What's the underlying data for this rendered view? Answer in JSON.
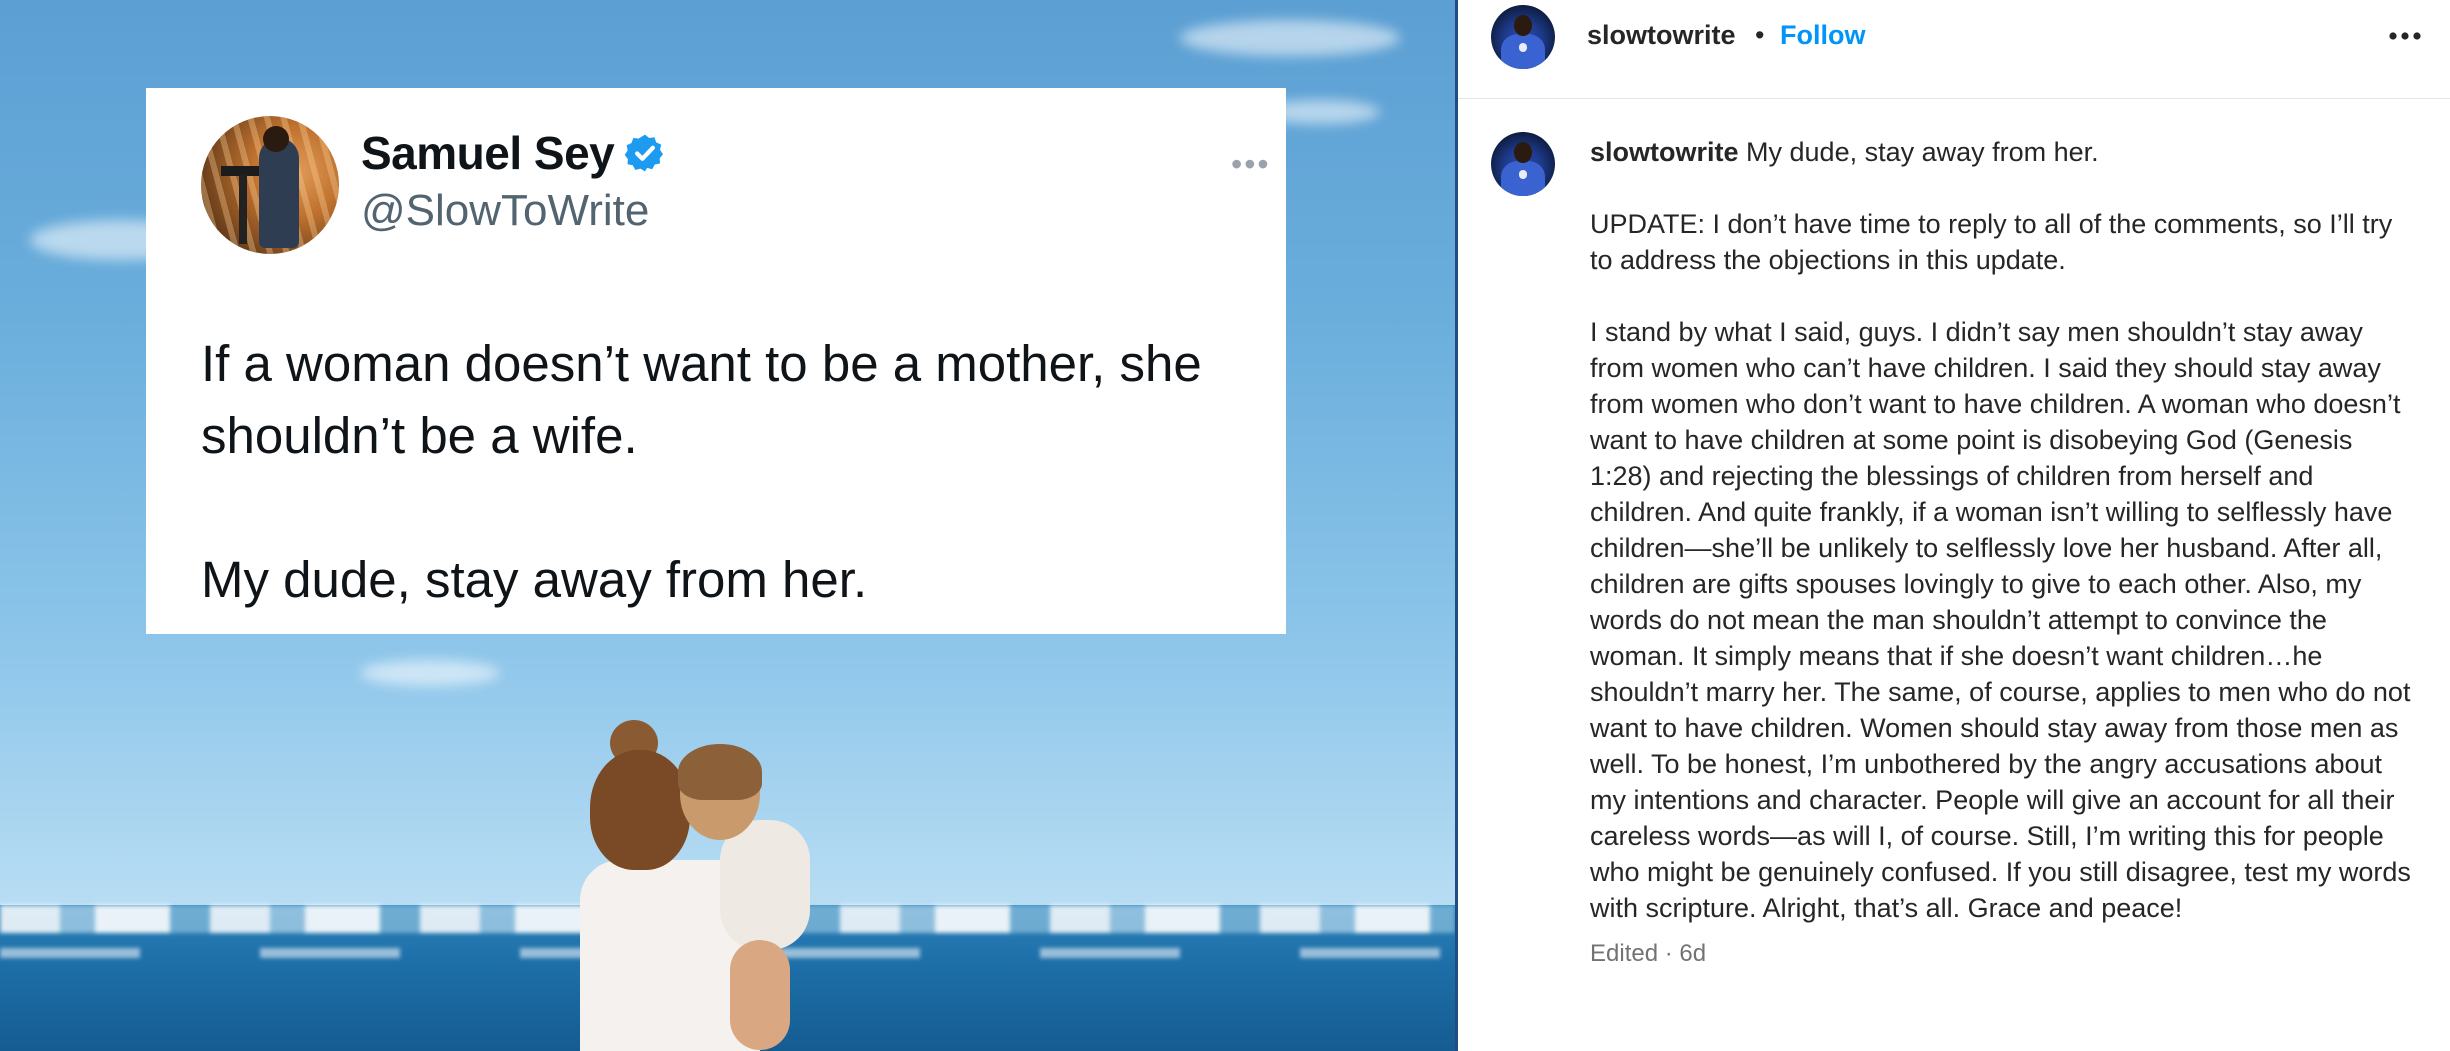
{
  "tweet": {
    "display_name": "Samuel Sey",
    "handle": "@SlowToWrite",
    "text": "If a woman doesn’t want to be a mother, she shouldn’t be a wife.\n\nMy dude, stay away from her."
  },
  "post": {
    "author": "slowtowrite",
    "separator": "•",
    "follow_label": "Follow",
    "caption_username": "slowtowrite",
    "caption_first_line": "My dude, stay away from her.",
    "caption_update": "UPDATE: I don’t have time to reply to all of the comments, so I’ll try to address the objections in this update.",
    "caption_body": "I stand by what I said, guys. I didn’t say men shouldn’t stay away from women who can’t have children. I said they should stay away from women who don’t want to have children. A woman who doesn’t want to have children at some point is disobeying God (Genesis 1:28) and rejecting the blessings of children from herself and children. And quite frankly, if a woman isn’t willing to selflessly have children—she’ll be unlikely to selflessly love her husband. After all, children are gifts spouses lovingly to give to each other. Also, my words do not mean the man shouldn’t attempt to convince the woman. It simply means that if she doesn’t want children…he shouldn’t marry her. The same, of course, applies to men who do not want to have children. Women should stay away from those men as well. To be honest, I’m unbothered by the angry accusations about my intentions and character. People will give an account for all their careless words—as will I, of course. Still, I’m writing this for people who might be genuinely confused. If you still disagree, test my words with scripture. Alright, that’s all. Grace and peace!",
    "meta": "Edited · 6d"
  },
  "icons": {
    "verified": "verified-badge-icon",
    "tweet_more": "more-horizontal-icon",
    "post_more": "more-horizontal-icon"
  },
  "colors": {
    "follow": "#0095f6",
    "verified": "#1d9bf0",
    "meta_text": "#737373"
  }
}
